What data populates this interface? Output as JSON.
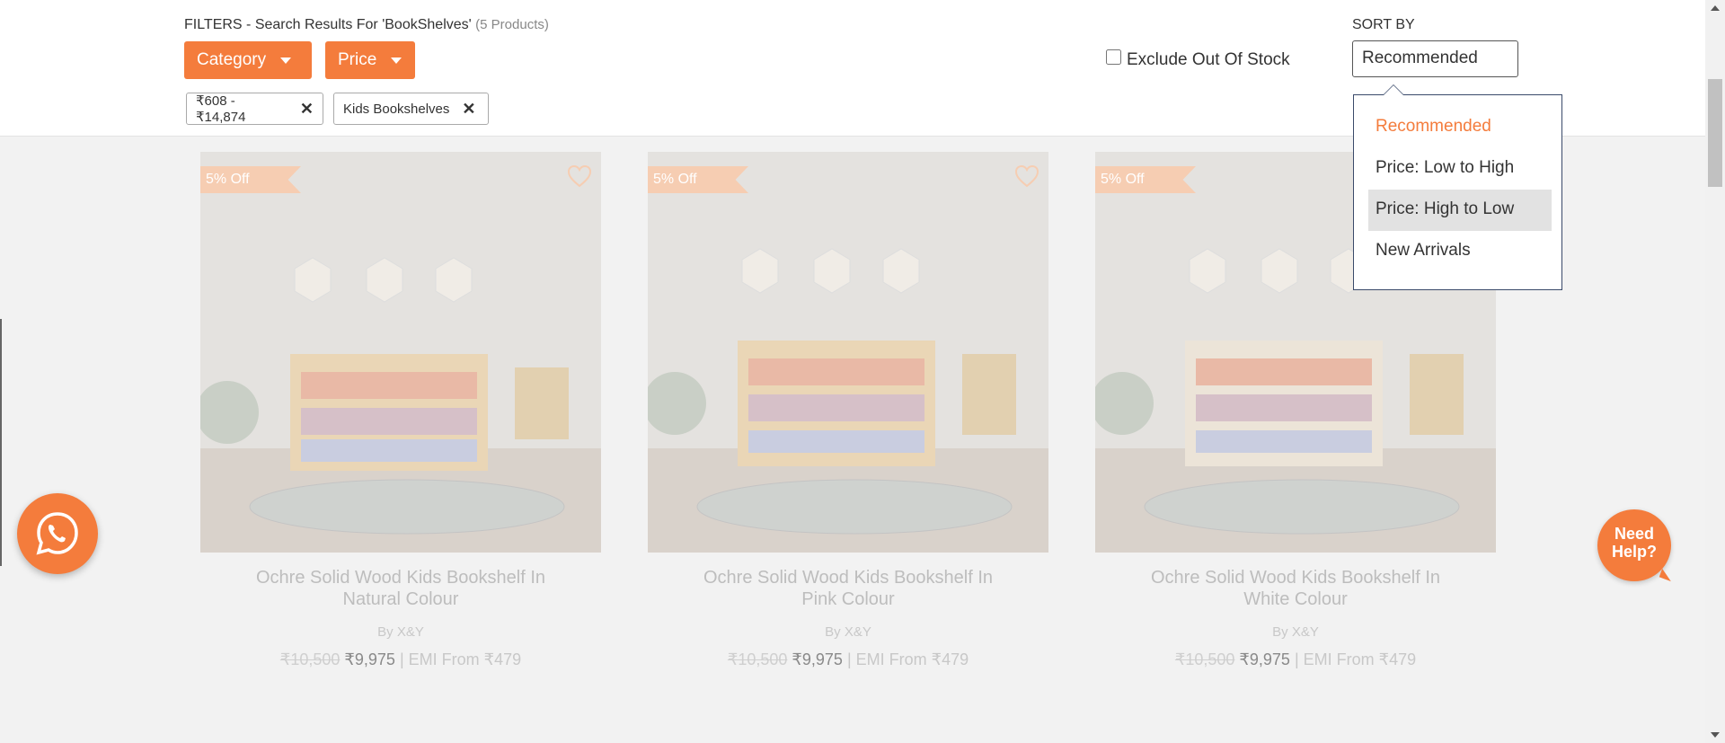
{
  "filters": {
    "title": "FILTERS - Search Results For 'BookShelves'",
    "count": "(5 Products)",
    "category_label": "Category",
    "price_label": "Price",
    "chips": [
      {
        "label": "₹608 - ₹14,874"
      },
      {
        "label": "Kids Bookshelves"
      }
    ],
    "exclude_label": "Exclude Out Of Stock"
  },
  "sort": {
    "label": "SORT BY",
    "selected": "Recommended",
    "options": [
      "Recommended",
      "Price: Low to High",
      "Price: High to Low",
      "New Arrivals"
    ]
  },
  "products": [
    {
      "badge": "5% Off",
      "title": "Ochre Solid Wood Kids Bookshelf In Natural Colour",
      "brand": "By X&Y",
      "mrp": "₹10,500",
      "price": "₹9,975",
      "emi": "| EMI From ₹479"
    },
    {
      "badge": "5% Off",
      "title": "Ochre Solid Wood Kids Bookshelf In Pink Colour",
      "brand": "By X&Y",
      "mrp": "₹10,500",
      "price": "₹9,975",
      "emi": "| EMI From ₹479"
    },
    {
      "badge": "5% Off",
      "title": "Ochre Solid Wood Kids Bookshelf In White Colour",
      "brand": "By X&Y",
      "mrp": "₹10,500",
      "price": "₹9,975",
      "emi": "| EMI From ₹479"
    }
  ],
  "help": {
    "line1": "Need",
    "line2": "Help?"
  },
  "colors": {
    "accent": "#f47c3c",
    "badge": "#f6cdb2",
    "overlay_bg": "#f2f2f2"
  }
}
